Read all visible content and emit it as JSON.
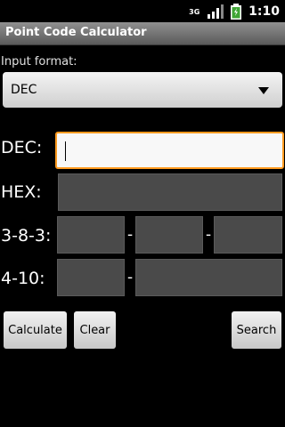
{
  "status": {
    "time": "1:10",
    "network": "3G"
  },
  "app": {
    "title": "Point Code Calculator"
  },
  "form": {
    "input_format_label": "Input format:",
    "input_format_value": "DEC",
    "dec_label": "DEC:",
    "hex_label": "HEX:",
    "f383_label": "3-8-3:",
    "f410_label": "4-10:",
    "dash": "-"
  },
  "buttons": {
    "calculate": "Calculate",
    "clear": "Clear",
    "search": "Search"
  },
  "colors": {
    "focus_border": "#ff9a1e",
    "field_bg": "#4a4a4a"
  }
}
